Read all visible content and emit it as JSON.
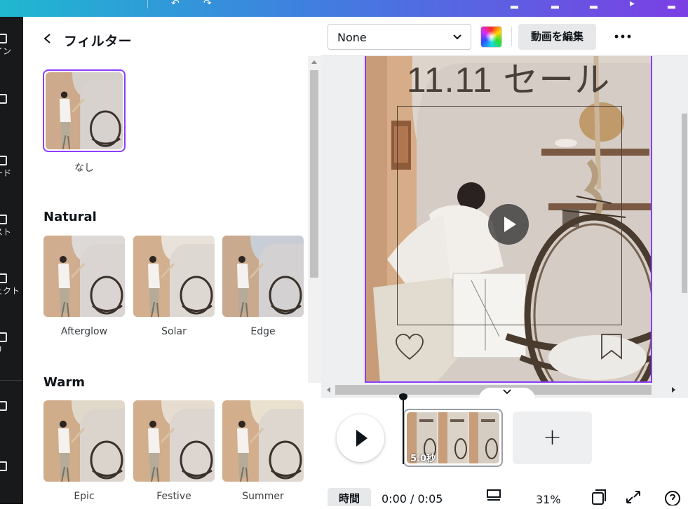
{
  "panel": {
    "title": "フィルター",
    "none_label": "なし",
    "sections": [
      {
        "title": "Natural",
        "items": [
          "Afterglow",
          "Solar",
          "Edge"
        ]
      },
      {
        "title": "Warm",
        "items": [
          "Epic",
          "Festive",
          "Summer"
        ]
      }
    ]
  },
  "toolbar": {
    "font_value": "None",
    "edit_label": "動画を編集"
  },
  "canvas": {
    "headline": "11.11 セール"
  },
  "timeline": {
    "clip_duration": "5.0秒",
    "add_label": "+",
    "time_tab": "時間",
    "time_display": "0:00 / 0:05",
    "zoom": "31%"
  },
  "rail": {
    "labels": [
      "イン",
      "",
      "ード",
      "スト",
      "ェクト",
      "リ",
      "",
      ""
    ]
  },
  "colors": {
    "accent": "#8b3dff",
    "rail_bg": "#18191b",
    "topbar_start": "#1fb8d0",
    "topbar_end": "#7b3fe4"
  }
}
